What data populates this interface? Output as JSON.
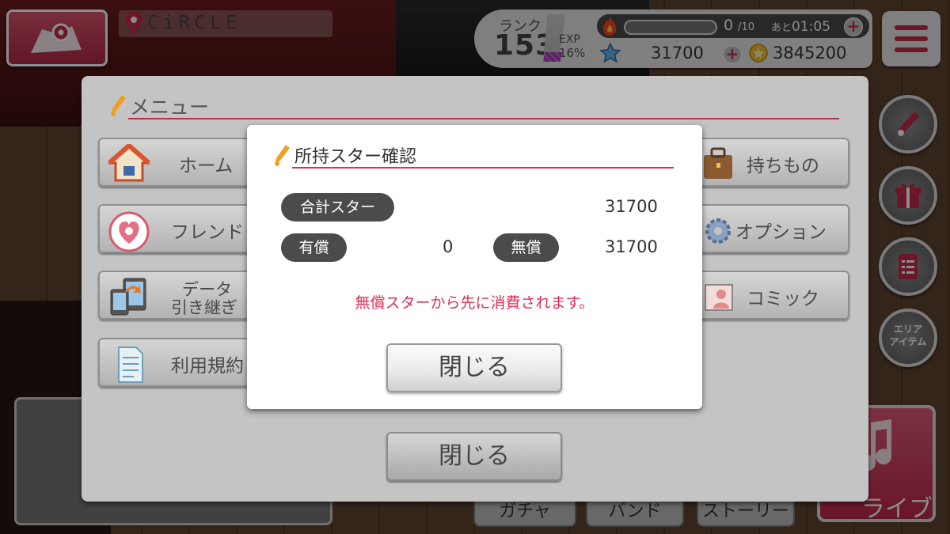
{
  "hud": {
    "circle_name": "CiRCLE",
    "rank_label": "ランク",
    "rank_value": "153",
    "exp_label": "EXP",
    "exp_percent": "16%",
    "exp_fraction": 0.16,
    "stamina_value": "0",
    "stamina_max": "/10",
    "stamina_ato": "あと",
    "stamina_timer": "01:05",
    "stamina_fraction": 0.0,
    "stars": "31700",
    "coins": "3845200",
    "plus_symbol": "+"
  },
  "side_buttons": {
    "area_item_label": "エリア\nアイテム",
    "icons": [
      "pen-icon",
      "gift-icon",
      "checklist-icon"
    ]
  },
  "bottom": {
    "gacha": "ガチャ",
    "band": "バンド",
    "story": "ストーリー",
    "live": "ライブ"
  },
  "menu": {
    "title": "メニュー",
    "home": "ホーム",
    "friend": "フレンド",
    "data_transfer_line1": "データ",
    "data_transfer_line2": "引き継ぎ",
    "terms": "利用規約",
    "items": "持ちもの",
    "options": "オプション",
    "comic": "コミック",
    "close": "閉じる"
  },
  "dialog": {
    "title": "所持スター確認",
    "total_label": "合計スター",
    "total_value": "31700",
    "paid_label": "有償",
    "paid_value": "0",
    "free_label": "無償",
    "free_value": "31700",
    "note": "無償スターから先に消費されます。",
    "close": "閉じる"
  },
  "colors": {
    "accent": "#e0305a",
    "brand_red": "#c22a4a",
    "pill": "#4b4b4b"
  }
}
